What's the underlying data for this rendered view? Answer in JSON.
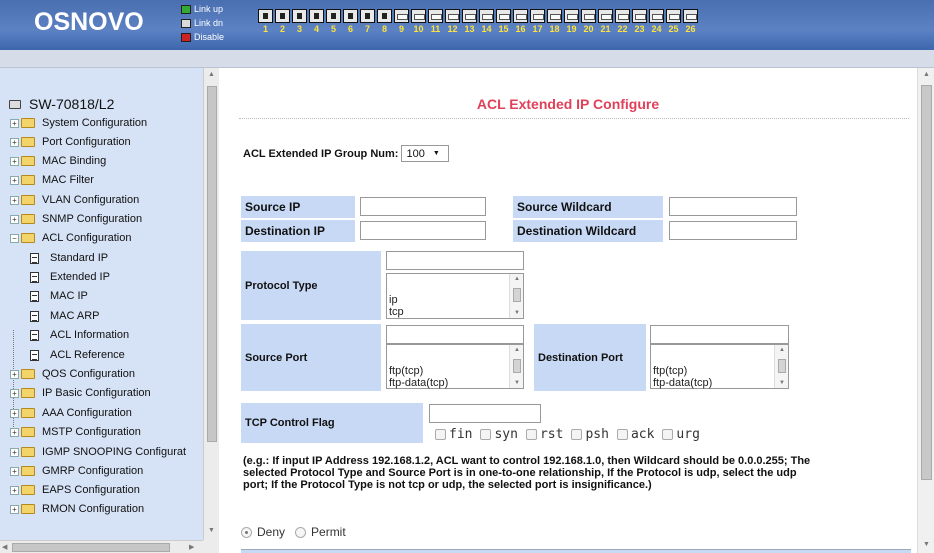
{
  "header": {
    "brand": "OSNOVO",
    "legend": [
      {
        "label": "Link up",
        "state": "up"
      },
      {
        "label": "Link dn",
        "state": "down"
      },
      {
        "label": "Disable",
        "state": "disabled"
      }
    ],
    "ports": [
      {
        "num": "1",
        "state": "up"
      },
      {
        "num": "2",
        "state": "up"
      },
      {
        "num": "3",
        "state": "up"
      },
      {
        "num": "4",
        "state": "up"
      },
      {
        "num": "5",
        "state": "up"
      },
      {
        "num": "6",
        "state": "up"
      },
      {
        "num": "7",
        "state": "up"
      },
      {
        "num": "8",
        "state": "up"
      },
      {
        "num": "9",
        "state": "down"
      },
      {
        "num": "10",
        "state": "down"
      },
      {
        "num": "11",
        "state": "down"
      },
      {
        "num": "12",
        "state": "down"
      },
      {
        "num": "13",
        "state": "down"
      },
      {
        "num": "14",
        "state": "down"
      },
      {
        "num": "15",
        "state": "down"
      },
      {
        "num": "16",
        "state": "down"
      },
      {
        "num": "17",
        "state": "down"
      },
      {
        "num": "18",
        "state": "down"
      },
      {
        "num": "19",
        "state": "down"
      },
      {
        "num": "20",
        "state": "down"
      },
      {
        "num": "21",
        "state": "down"
      },
      {
        "num": "22",
        "state": "down"
      },
      {
        "num": "23",
        "state": "down"
      },
      {
        "num": "24",
        "state": "down"
      },
      {
        "num": "25",
        "state": "down"
      },
      {
        "num": "26",
        "state": "down"
      }
    ]
  },
  "sidebar": {
    "root": "SW-70818/L2",
    "items": [
      {
        "label": "System Configuration",
        "type": "folder"
      },
      {
        "label": "Port Configuration",
        "type": "folder"
      },
      {
        "label": "MAC Binding",
        "type": "folder"
      },
      {
        "label": "MAC Filter",
        "type": "folder"
      },
      {
        "label": "VLAN Configuration",
        "type": "folder"
      },
      {
        "label": "SNMP Configuration",
        "type": "folder"
      },
      {
        "label": "ACL Configuration",
        "type": "folder-open"
      },
      {
        "label": "Standard IP",
        "type": "page"
      },
      {
        "label": "Extended IP",
        "type": "page"
      },
      {
        "label": "MAC IP",
        "type": "page"
      },
      {
        "label": "MAC ARP",
        "type": "page"
      },
      {
        "label": "ACL Information",
        "type": "page"
      },
      {
        "label": "ACL Reference",
        "type": "page"
      },
      {
        "label": "QOS Configuration",
        "type": "folder"
      },
      {
        "label": "IP Basic Configuration",
        "type": "folder"
      },
      {
        "label": "AAA Configuration",
        "type": "folder"
      },
      {
        "label": "MSTP Configuration",
        "type": "folder"
      },
      {
        "label": "IGMP SNOOPING Configurat",
        "type": "folder"
      },
      {
        "label": "GMRP Configuration",
        "type": "folder"
      },
      {
        "label": "EAPS Configuration",
        "type": "folder"
      },
      {
        "label": "RMON Configuration",
        "type": "folder"
      }
    ]
  },
  "main": {
    "title": "ACL Extended IP Configure",
    "group_label": "ACL Extended IP Group Num:",
    "group_value": "100",
    "source_ip_label": "Source IP",
    "source_wildcard_label": "Source Wildcard",
    "destination_ip_label": "Destination IP",
    "destination_wildcard_label": "Destination Wildcard",
    "protocol_type_label": "Protocol Type",
    "protocol_options": [
      "ip",
      "tcp"
    ],
    "source_port_label": "Source Port",
    "source_port_options": [
      "ftp(tcp)",
      "ftp-data(tcp)"
    ],
    "destination_port_label": "Destination Port",
    "destination_port_options": [
      "ftp(tcp)",
      "ftp-data(tcp)"
    ],
    "tcp_flag_label": "TCP Control Flag",
    "tcp_flags": [
      "fin",
      "syn",
      "rst",
      "psh",
      "ack",
      "urg"
    ],
    "note": "(e.g.: If input IP Address 192.168.1.2, ACL want to control 192.168.1.0, then Wildcard should be 0.0.0.255; The selected Protocol Type and Source Port is in one-to-one relationship, If the Protocol is udp, select the udp port; If the Protocol Type is not tcp or udp, the selected port is insignificance.)",
    "deny_label": "Deny",
    "permit_label": "Permit"
  }
}
